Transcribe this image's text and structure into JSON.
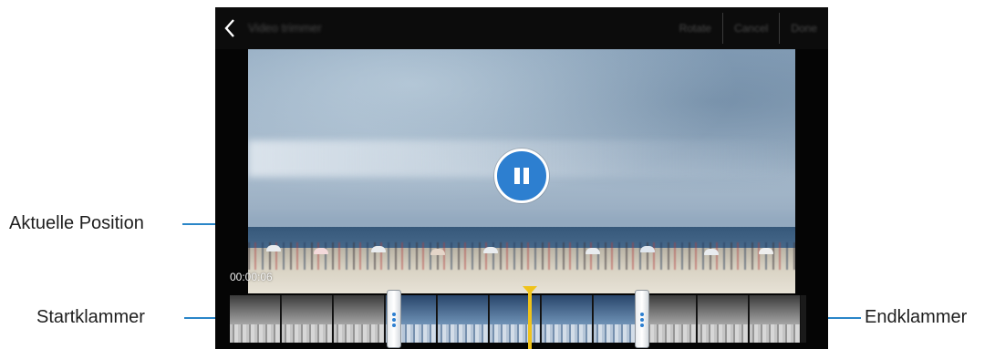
{
  "screen": {
    "app_title": "Video trimmer",
    "actions": [
      "Rotate",
      "Cancel",
      "Done"
    ],
    "timecode": "00:00:06"
  },
  "callouts": {
    "current_position": "Aktuelle Position",
    "start_clamp": "Startklammer",
    "end_clamp": "Endklammer"
  },
  "icons": {
    "back": "chevron-left-icon",
    "playback": "pause-icon"
  },
  "colors": {
    "accent_blue": "#2d7fd0",
    "playhead_yellow": "#f0c31a",
    "leader_line": "#2a86c8"
  }
}
